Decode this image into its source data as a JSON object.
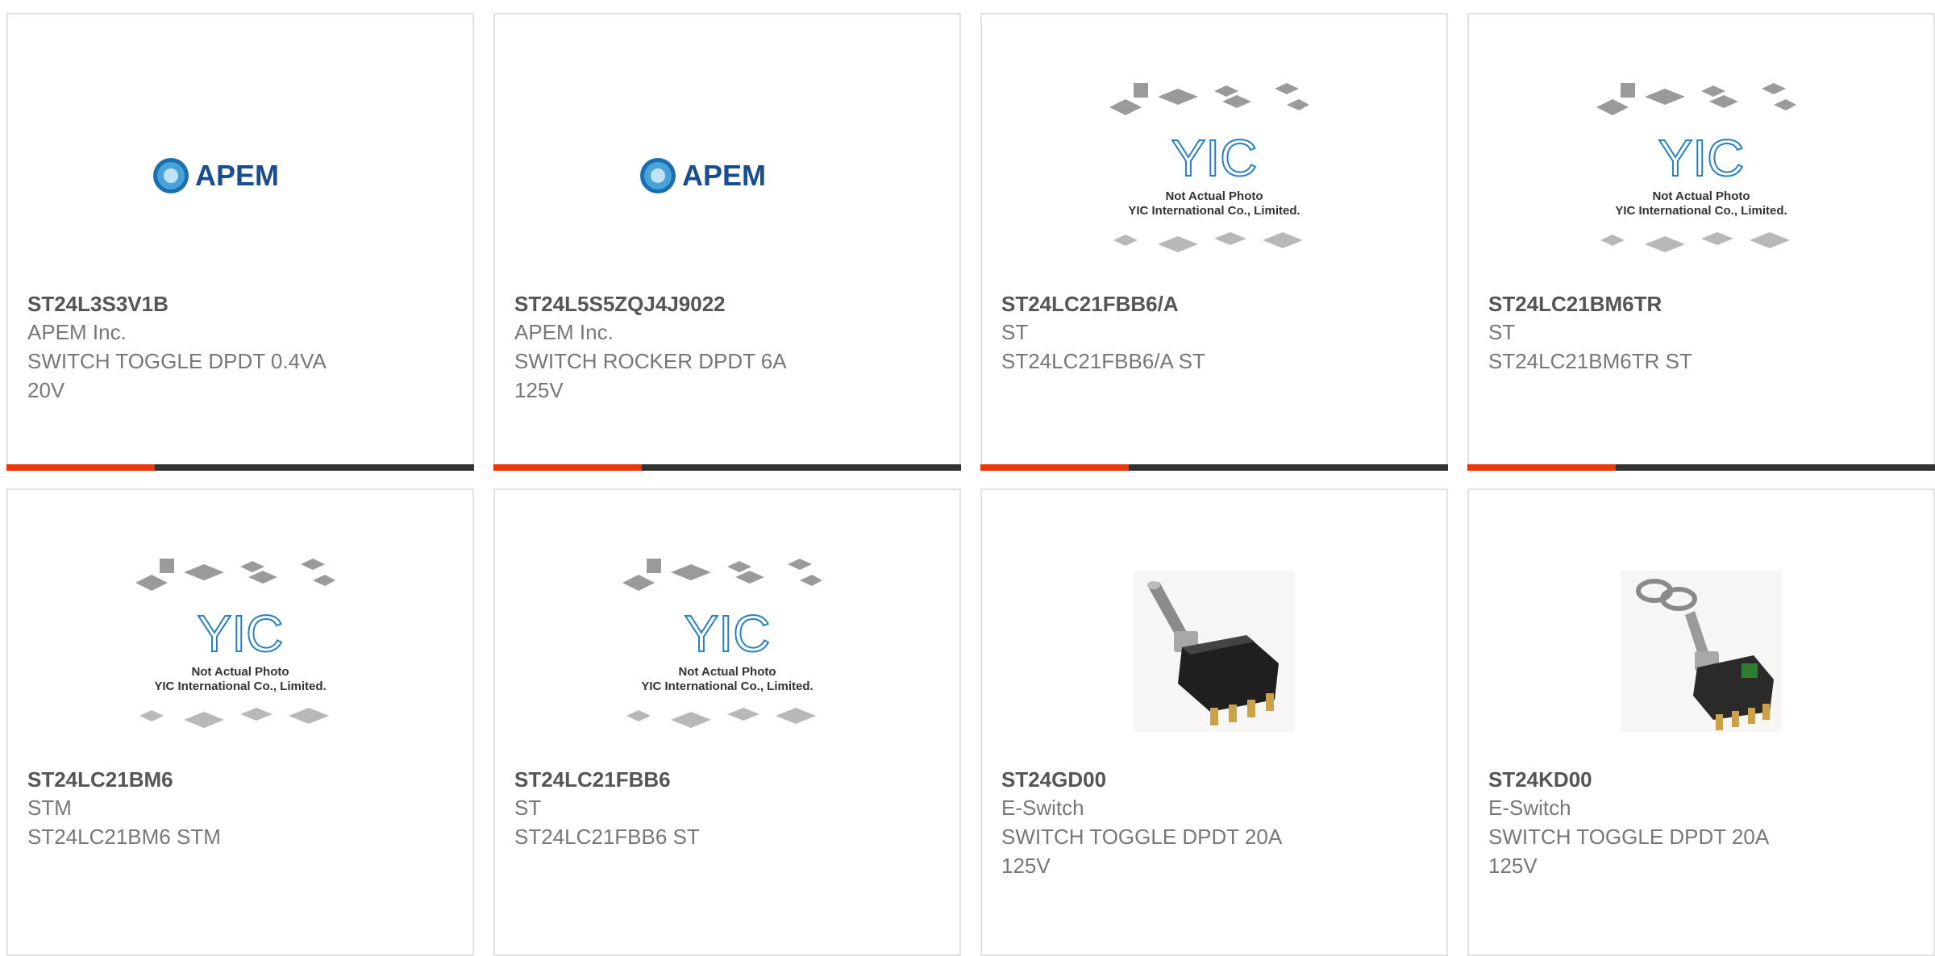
{
  "cards": [
    {
      "part": "ST24L3S3V1B",
      "manufacturer": "APEM Inc.",
      "desc1": "SWITCH TOGGLE DPDT 0.4VA",
      "desc2": "20V",
      "image": "apem-logo",
      "logo_text": "APEM",
      "accent": "#e8390e"
    },
    {
      "part": "ST24L5S5ZQJ4J9022",
      "manufacturer": "APEM Inc.",
      "desc1": "SWITCH ROCKER DPDT 6A",
      "desc2": "125V",
      "image": "apem-logo",
      "logo_text": "APEM",
      "accent": "#e8390e"
    },
    {
      "part": "ST24LC21FBB6/A",
      "manufacturer": "ST",
      "desc1": "ST24LC21FBB6/A ST",
      "desc2": "",
      "image": "yic-placeholder",
      "placeholder_line1": "Not Actual Photo",
      "placeholder_line2": "YIC International Co., Limited.",
      "accent": "#e8390e"
    },
    {
      "part": "ST24LC21BM6TR",
      "manufacturer": "ST",
      "desc1": "ST24LC21BM6TR ST",
      "desc2": "",
      "image": "yic-placeholder",
      "placeholder_line1": "Not Actual Photo",
      "placeholder_line2": "YIC International Co., Limited.",
      "accent": "#e8390e"
    },
    {
      "part": "ST24LC21BM6",
      "manufacturer": "STM",
      "desc1": "ST24LC21BM6 STM",
      "desc2": "",
      "image": "yic-placeholder",
      "placeholder_line1": "Not Actual Photo",
      "placeholder_line2": "YIC International Co., Limited."
    },
    {
      "part": "ST24LC21FBB6",
      "manufacturer": "ST",
      "desc1": "ST24LC21FBB6 ST",
      "desc2": "",
      "image": "yic-placeholder",
      "placeholder_line1": "Not Actual Photo",
      "placeholder_line2": "YIC International Co., Limited."
    },
    {
      "part": "ST24GD00",
      "manufacturer": "E-Switch",
      "desc1": "SWITCH TOGGLE DPDT 20A",
      "desc2": "125V",
      "image": "toggle-switch-photo"
    },
    {
      "part": "ST24KD00",
      "manufacturer": "E-Switch",
      "desc1": "SWITCH TOGGLE DPDT 20A",
      "desc2": "125V",
      "image": "toggle-switch-photo-with-nuts"
    }
  ],
  "colors": {
    "accent": "#e8390e",
    "bar_dark": "#333333",
    "part_text": "#555555",
    "meta_text": "#777777",
    "apem_blue": "#1a4d8f",
    "yic_blue": "#2a7fc0"
  }
}
